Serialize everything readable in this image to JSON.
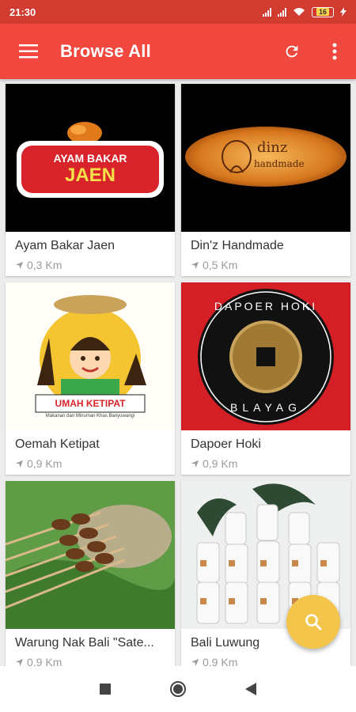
{
  "status_bar": {
    "time": "21:30",
    "battery": "16"
  },
  "app_bar": {
    "title": "Browse All",
    "menu_icon": "hamburger-icon",
    "refresh_icon": "refresh-icon",
    "more_icon": "more-vert-icon"
  },
  "stores": [
    {
      "name": "Ayam Bakar Jaen",
      "distance": "0,3 Km",
      "logo_text": "AYAM BAKAR",
      "logo_text2": "JAEN"
    },
    {
      "name": "Din'z Handmade",
      "distance": "0,5 Km",
      "logo_text": "dinz",
      "logo_text2": "handmade"
    },
    {
      "name": "Oemah Ketipat",
      "distance": "0,9 Km",
      "logo_text": "UMAH KETIPAT",
      "logo_text2": "Makanan dan Minuman Khas Banyuwangi"
    },
    {
      "name": "Dapoer Hoki",
      "distance": "0,9 Km",
      "logo_text": "DAPOER HOKI",
      "logo_text2": "BLAYAG"
    },
    {
      "name": "Warung Nak Bali \"Sate...",
      "distance": "0,9 Km"
    },
    {
      "name": "Bali Luwung",
      "distance": "0,9 Km"
    }
  ],
  "fab": {
    "icon": "search-icon"
  },
  "colors": {
    "status_bar": "#d13b30",
    "app_bar": "#f0483e",
    "fab": "#f3c64b"
  }
}
